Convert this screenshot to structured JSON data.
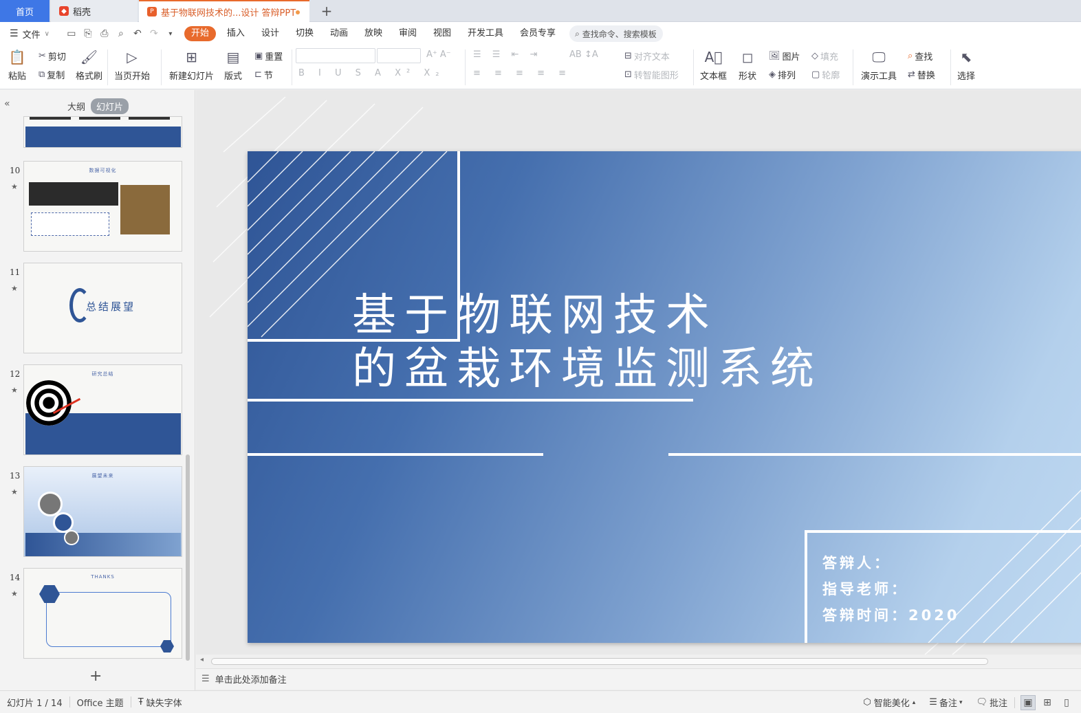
{
  "tabs": {
    "home": "首页",
    "daoke": "稻壳",
    "document": "基于物联网技术的...设计 答辩PPT",
    "add": "+"
  },
  "menu": {
    "file": "文件",
    "tabs": [
      "开始",
      "插入",
      "设计",
      "切换",
      "动画",
      "放映",
      "审阅",
      "视图",
      "开发工具",
      "会员专享"
    ],
    "search_placeholder": "查找命令、搜索模板"
  },
  "ribbon": {
    "paste": "粘贴",
    "cut": "剪切",
    "copy": "复制",
    "format_painter": "格式刷",
    "start_from_current": "当页开始",
    "new_slide": "新建幻灯片",
    "layout": "版式",
    "reset": "重置",
    "section": "节",
    "align_text": "对齐文本",
    "convert_smartart": "转智能图形",
    "text_box": "文本框",
    "shape": "形状",
    "picture": "图片",
    "arrange": "排列",
    "fill": "填充",
    "outline": "轮廓",
    "present_tools": "演示工具",
    "find": "查找",
    "replace": "替换",
    "select": "选择"
  },
  "left_panel": {
    "outline_tab": "大纲",
    "slides_tab": "幻灯片",
    "thumbnails": [
      {
        "num": "10",
        "title": "数据可视化"
      },
      {
        "num": "11",
        "title": "总结展望"
      },
      {
        "num": "12",
        "title": "研究总结"
      },
      {
        "num": "13",
        "title": "展望未来"
      },
      {
        "num": "14",
        "title": "THANKS"
      }
    ],
    "add_slide": "+"
  },
  "slide": {
    "title_line1": "基于物联网技术",
    "title_line2": "的盆栽环境监测系统",
    "defender": "答辩人：",
    "advisor": "指导老师：",
    "date": "答辩时间：2020"
  },
  "notes_placeholder": "单击此处添加备注",
  "status": {
    "slide_count": "幻灯片 1 / 14",
    "theme": "Office 主题",
    "missing_font": "缺失字体",
    "smart_beautify": "智能美化",
    "notes": "备注",
    "comments": "批注"
  },
  "colors": {
    "accent": "#e86a2c",
    "home_tab": "#3e77e6",
    "slide_dark": "#2f5596",
    "slide_light": "#c3dcf3"
  }
}
